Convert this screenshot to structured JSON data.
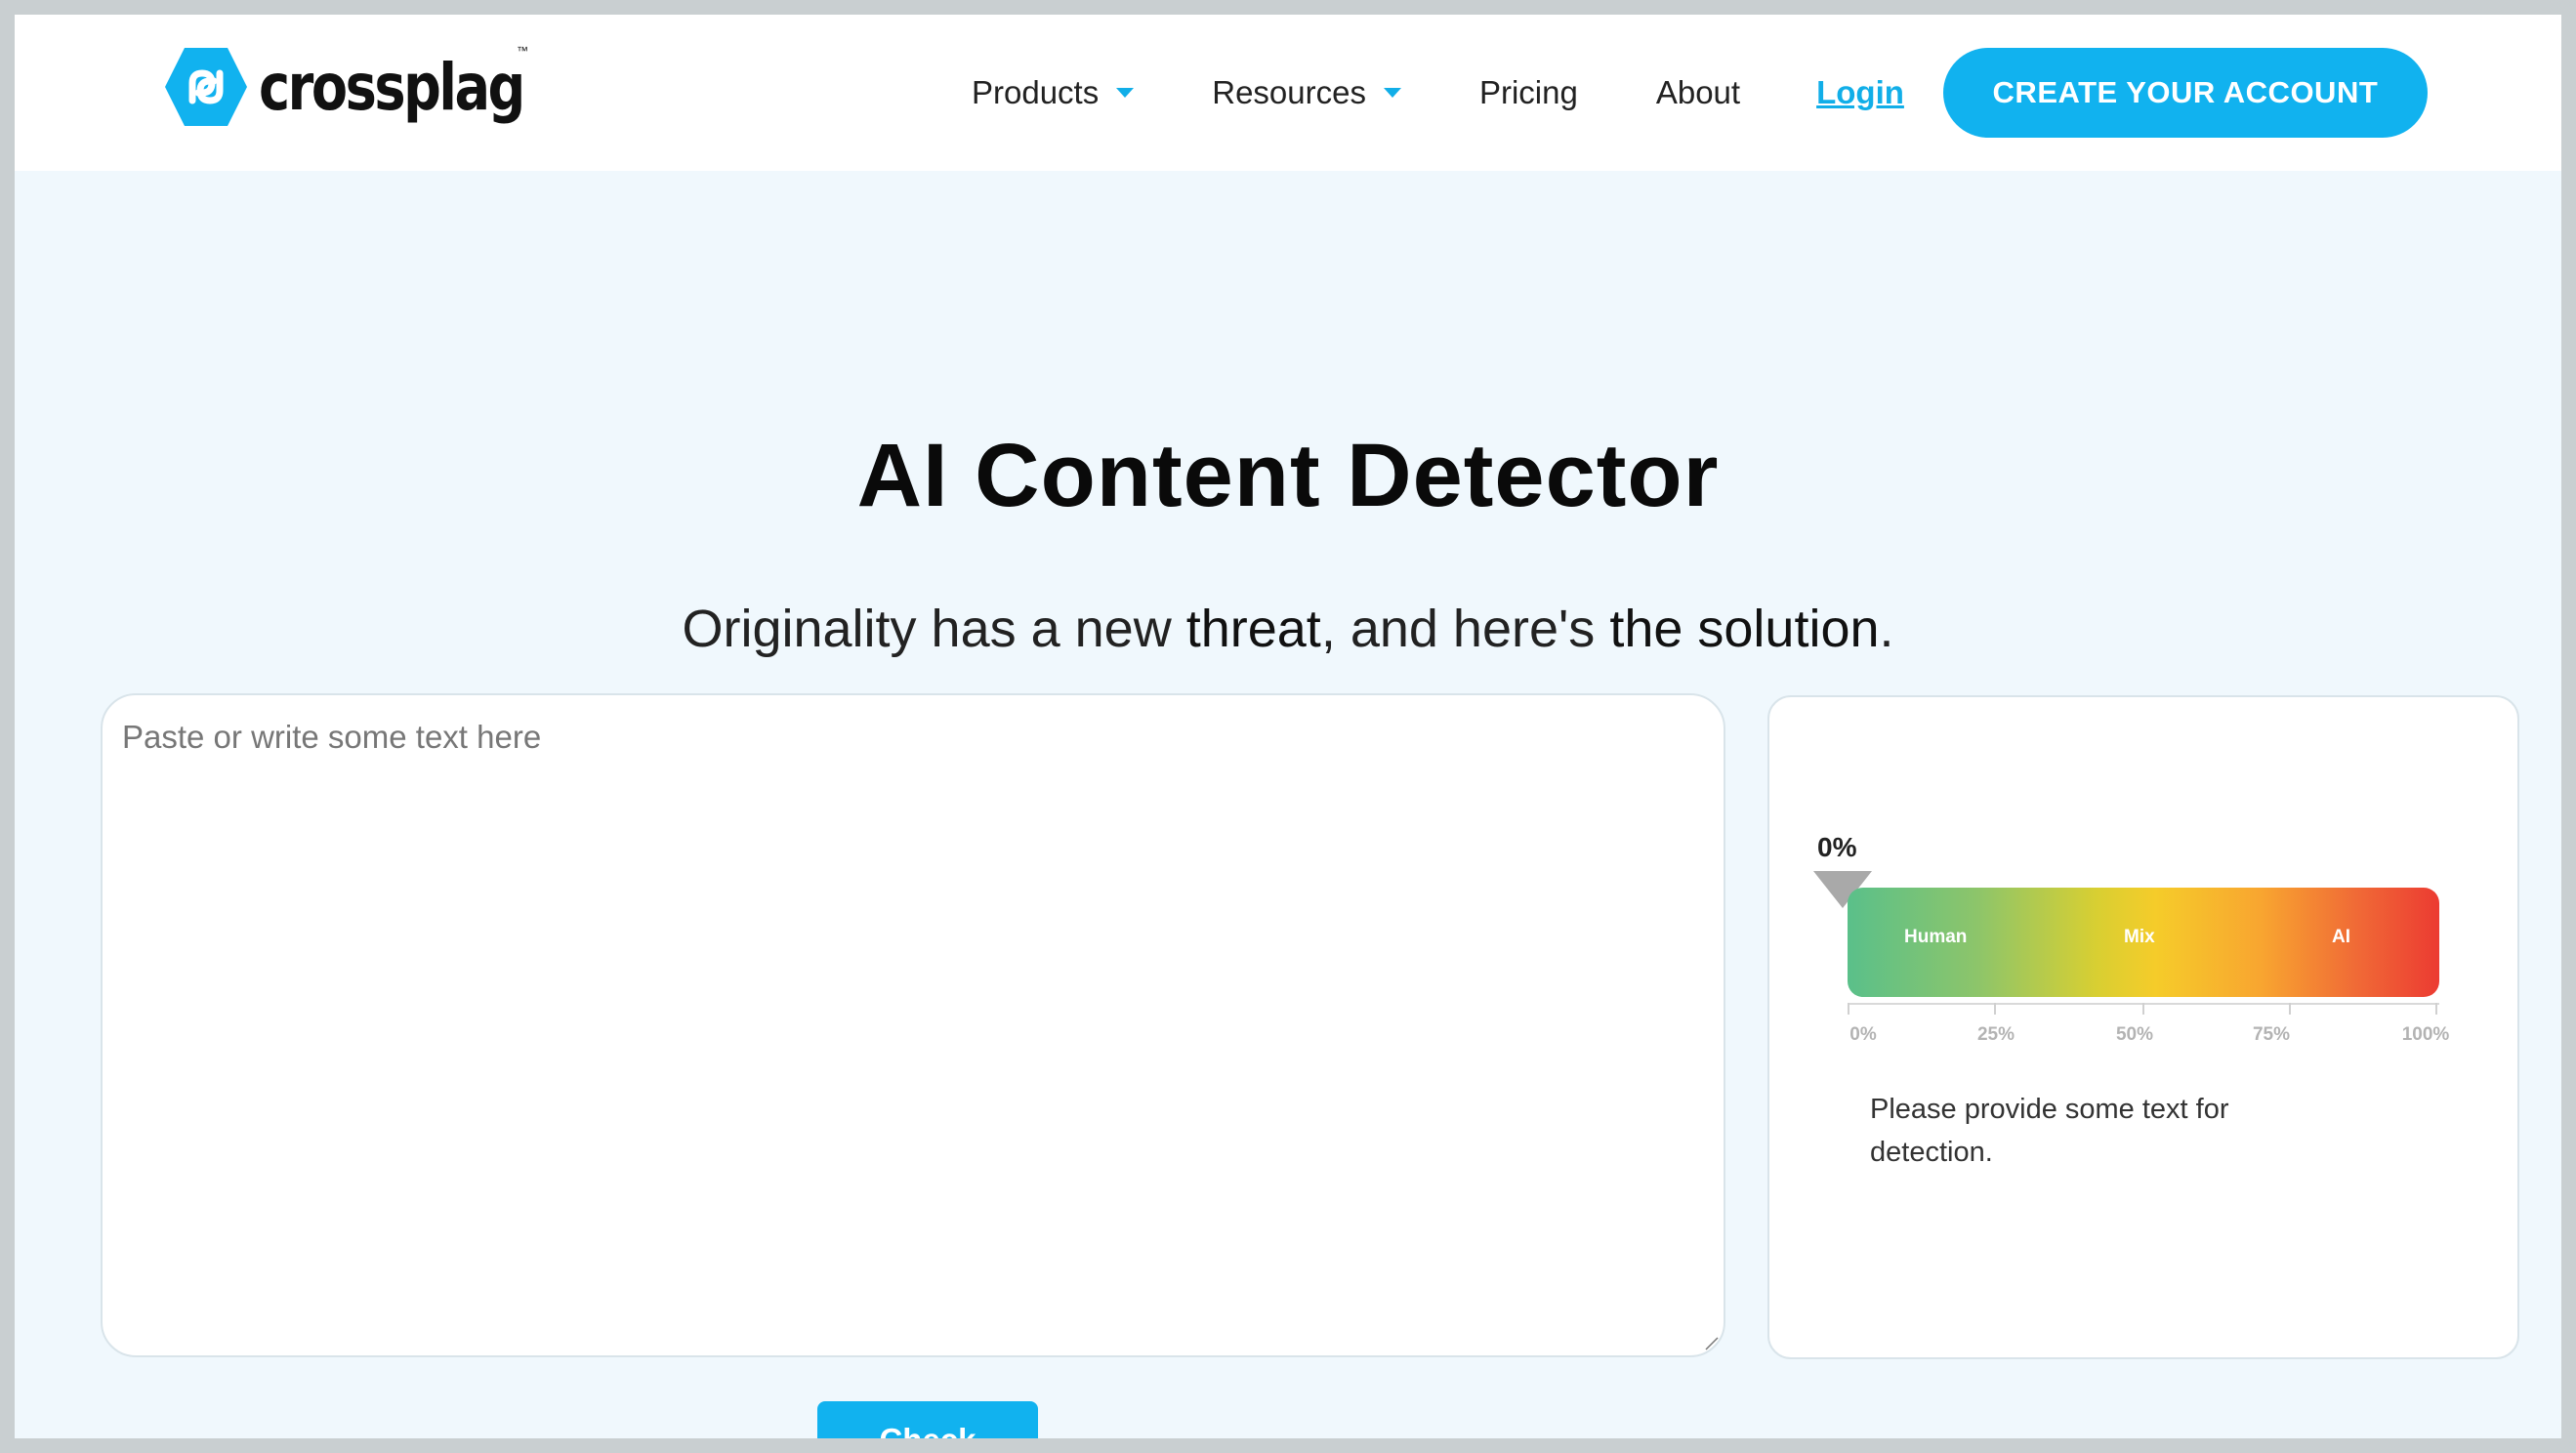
{
  "brand": {
    "name": "crossplag",
    "trademark": "™",
    "accent": "#11b2ef"
  },
  "nav": {
    "items": [
      {
        "label": "Products",
        "dropdown": true
      },
      {
        "label": "Resources",
        "dropdown": true
      },
      {
        "label": "Pricing",
        "dropdown": false
      },
      {
        "label": "About",
        "dropdown": false
      }
    ],
    "login_label": "Login",
    "cta_label": "CREATE YOUR ACCOUNT"
  },
  "hero": {
    "title": "AI Content Detector",
    "subtitle_part1": "Originality has a new ",
    "subtitle_em1": "threat",
    "subtitle_part2": ", and here's ",
    "subtitle_em2": "the solution",
    "subtitle_part3": "."
  },
  "input": {
    "placeholder": "Paste or write some text here",
    "value": ""
  },
  "result": {
    "score_label": "0%",
    "score_value": 0,
    "gauge_labels": [
      "Human",
      "Mix",
      "AI"
    ],
    "scale_ticks": [
      "0%",
      "25%",
      "50%",
      "75%",
      "100%"
    ],
    "message": "Please provide some text for detection."
  },
  "actions": {
    "check_label": "Check"
  }
}
